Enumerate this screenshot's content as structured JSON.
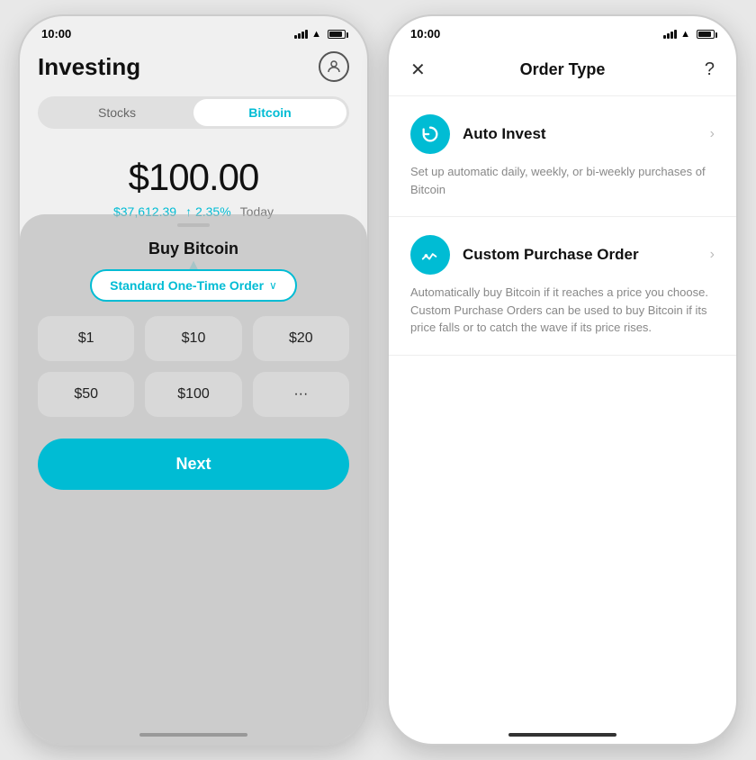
{
  "leftPhone": {
    "statusBar": {
      "time": "10:00"
    },
    "header": {
      "title": "Investing"
    },
    "tabs": [
      {
        "label": "Stocks",
        "active": false
      },
      {
        "label": "Bitcoin",
        "active": true
      }
    ],
    "price": {
      "main": "$100.00",
      "btcPrice": "$37,612.39",
      "change": "↑ 2.35%",
      "period": "Today"
    },
    "modal": {
      "title": "Buy Bitcoin",
      "orderType": "Standard One-Time Order ∨",
      "amounts": [
        "$1",
        "$10",
        "$20",
        "$50",
        "$100",
        "···"
      ],
      "nextButton": "Next"
    }
  },
  "rightPhone": {
    "statusBar": {
      "time": "10:00"
    },
    "header": {
      "close": "✕",
      "title": "Order Type",
      "help": "?"
    },
    "options": [
      {
        "icon": "↺",
        "name": "Auto Invest",
        "description": "Set up automatic daily, weekly, or bi-weekly purchases of Bitcoin"
      },
      {
        "icon": "⟳",
        "name": "Custom Purchase Order",
        "description": "Automatically buy Bitcoin if it reaches a price you choose. Custom Purchase Orders can be used to buy Bitcoin if its price falls or to catch the wave if its price rises."
      }
    ]
  }
}
